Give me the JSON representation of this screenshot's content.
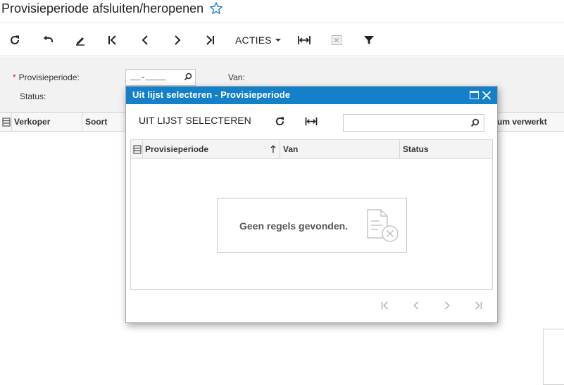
{
  "page": {
    "title": "Provisieperiode afsluiten/heropenen"
  },
  "toolbar": {
    "acties_label": "ACTIES"
  },
  "form": {
    "period_label": "Provisieperiode:",
    "period_value": "__-____",
    "van_label": "Van:",
    "status_label": "Status:"
  },
  "grid": {
    "columns": [
      "Verkoper",
      "Soort",
      "um verwerkt"
    ]
  },
  "dialog": {
    "title": "Uit lijst selecteren - Provisieperiode",
    "action_label": "UIT LIJST SELECTEREN",
    "search_placeholder": "",
    "columns": {
      "period": "Provisieperiode",
      "van": "Van",
      "status": "Status"
    },
    "empty_message": "Geen regels gevonden."
  },
  "colors": {
    "dialog_header": "#1380c9",
    "star": "#1a7fd4",
    "required": "#d9252c"
  }
}
